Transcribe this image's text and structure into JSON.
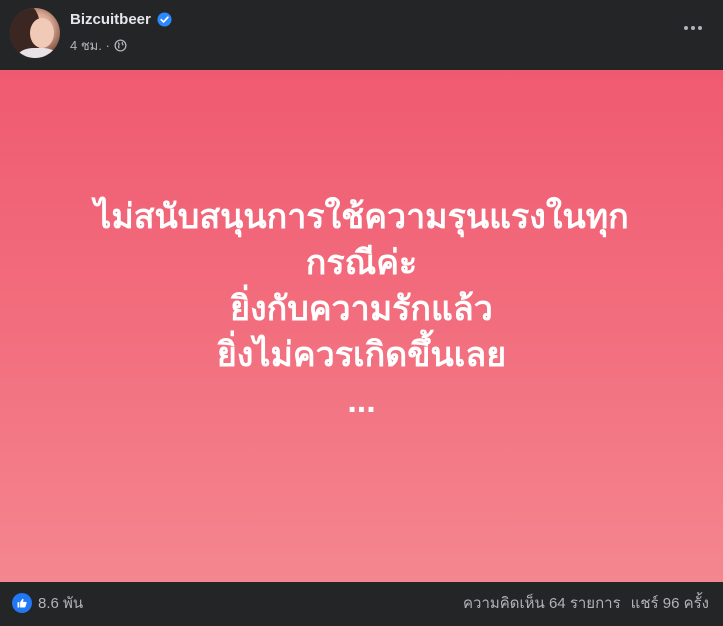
{
  "author": {
    "name": "Bizcuitbeer",
    "verified_icon": "verified-badge-icon",
    "time": "4 ชม. ·",
    "privacy_icon": "globe-icon"
  },
  "post": {
    "background_colors": [
      "#f05a71",
      "#f4868f"
    ],
    "text": "ไม่สนับสนุนการใช้ความรุนแรงในทุก\nกรณีค่ะ\nยิ่งกับความรักแล้ว\nยิ่งไม่ควรเกิดขึ้นเลย\n..."
  },
  "footer": {
    "reaction_icon": "like-icon",
    "reaction_count": "8.6 พัน",
    "comments": "ความคิดเห็น 64 รายการ",
    "shares": "แชร์ 96 ครั้ง"
  },
  "colors": {
    "background": "#242526",
    "text_primary": "#e4e6eb",
    "text_secondary": "#b0b3b8",
    "accent": "#2078f4"
  }
}
